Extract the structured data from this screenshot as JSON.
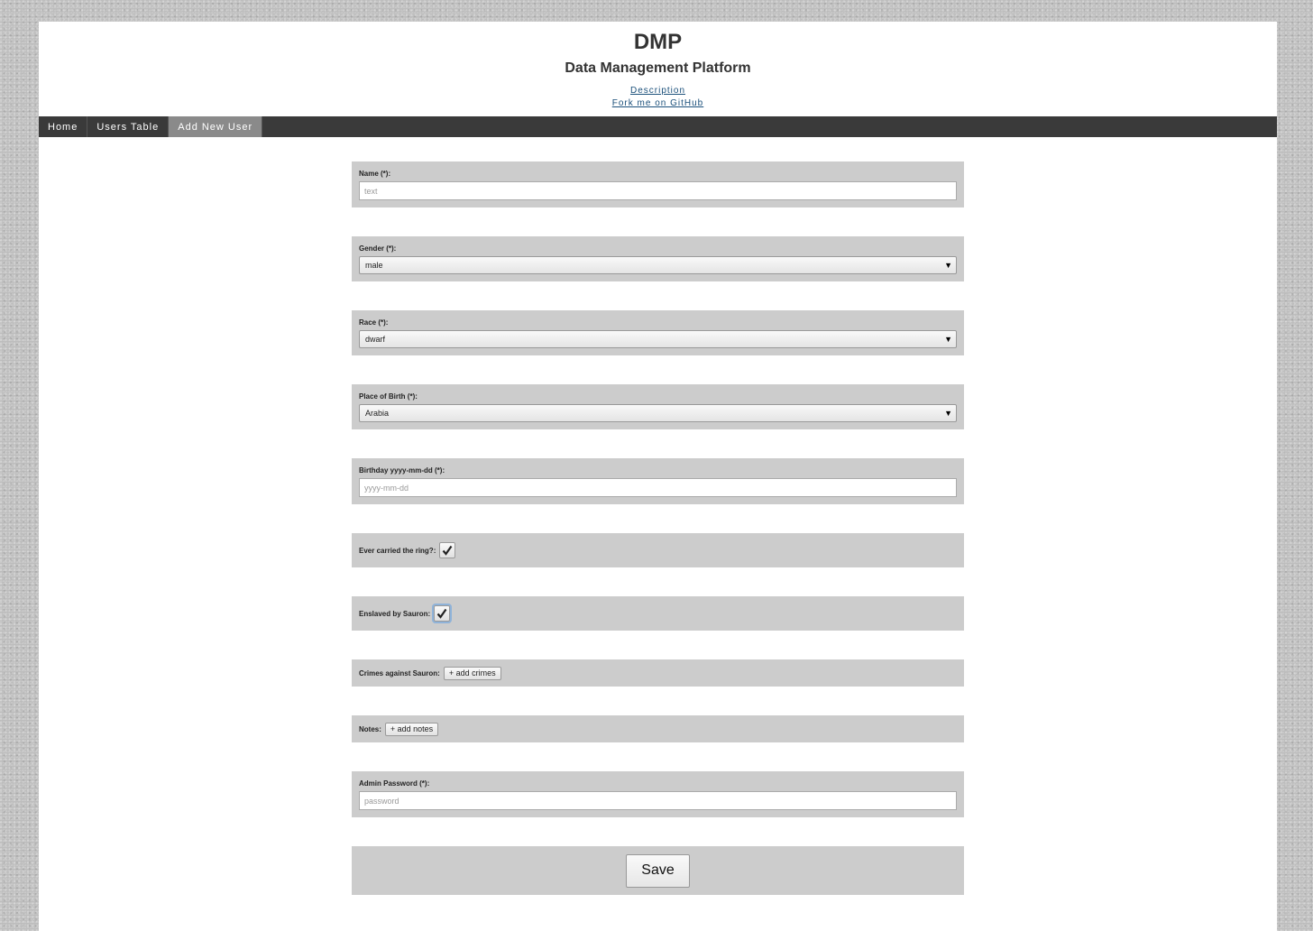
{
  "header": {
    "title": "DMP",
    "subtitle": "Data Management Platform",
    "links": [
      "Description",
      "Fork me on GitHub"
    ]
  },
  "nav": {
    "items": [
      {
        "label": "Home",
        "active": false
      },
      {
        "label": "Users Table",
        "active": false
      },
      {
        "label": "Add New User",
        "active": true
      }
    ]
  },
  "form": {
    "name": {
      "label": "Name (*):",
      "placeholder": "text",
      "value": ""
    },
    "gender": {
      "label": "Gender (*):",
      "selected": "male"
    },
    "race": {
      "label": "Race (*):",
      "selected": "dwarf"
    },
    "birthplace": {
      "label": "Place of Birth (*):",
      "selected": "Arabia"
    },
    "birthday": {
      "label": "Birthday yyyy-mm-dd (*):",
      "placeholder": "yyyy-mm-dd",
      "value": ""
    },
    "ring": {
      "label": "Ever carried the ring?:",
      "checked": true
    },
    "enslaved": {
      "label": "Enslaved by Sauron:",
      "checked": true
    },
    "crimes": {
      "label": "Crimes against Sauron:",
      "button": "+ add crimes"
    },
    "notes": {
      "label": "Notes:",
      "button": "+ add notes"
    },
    "password": {
      "label": "Admin Password (*):",
      "placeholder": "password",
      "value": ""
    },
    "save": "Save"
  },
  "icons": {
    "select_arrow": "chevron-down-icon",
    "check": "check-icon"
  }
}
